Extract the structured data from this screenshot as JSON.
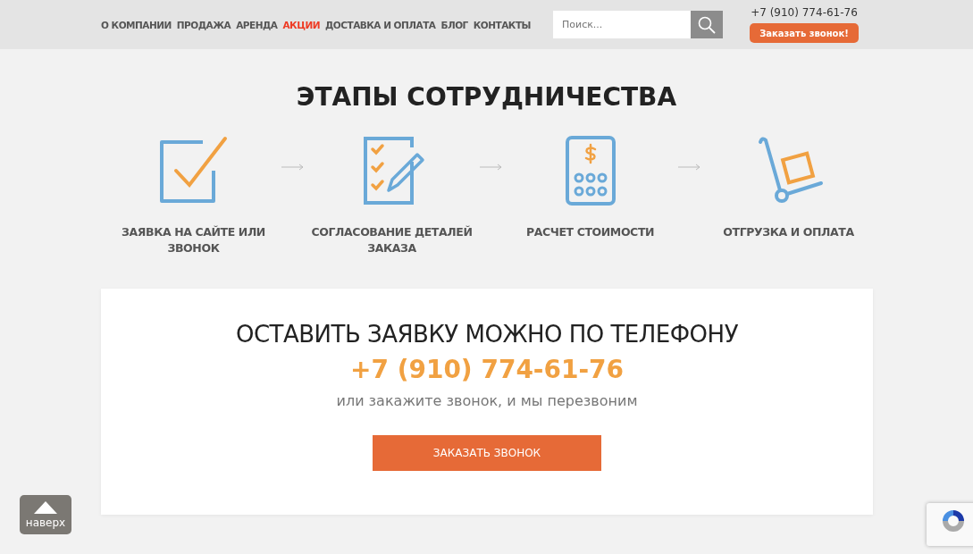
{
  "nav": [
    {
      "label": "О КОМПАНИИ",
      "selected": false
    },
    {
      "label": "ПРОДАЖА",
      "selected": false
    },
    {
      "label": "АРЕНДА",
      "selected": false
    },
    {
      "label": "АКЦИИ",
      "selected": true
    },
    {
      "label": "ДОСТАВКА И ОПЛАТА",
      "selected": false
    },
    {
      "label": "БЛОГ",
      "selected": false
    },
    {
      "label": "КОНТАКТЫ",
      "selected": false
    }
  ],
  "search": {
    "placeholder": "Поиск..."
  },
  "header_phone": "+7 (910) 774-61-76",
  "header_button": "Заказать звонок!",
  "title": "ЭТАПЫ СОТРУДНИЧЕСТВА",
  "steps": [
    {
      "kind": "checkbox",
      "label": "ЗАЯВКА НА САЙТЕ ИЛИ ЗВОНОК"
    },
    {
      "kind": "checklist",
      "label": "СОГЛАСОВАНИЕ ДЕТАЛЕЙ ЗАКАЗА"
    },
    {
      "kind": "calculator",
      "label": "РАСЧЕТ СТОИМОСТИ"
    },
    {
      "kind": "cart",
      "label": "ОТГРУЗКА И ОПЛАТА"
    }
  ],
  "callout": {
    "heading": "ОСТАВИТЬ ЗАЯВКУ МОЖНО ПО ТЕЛЕФОНУ",
    "phone": "+7 (910) 774-61-76",
    "note": "или закажите звонок, и мы перезвоним",
    "button": "ЗАКАЗАТЬ ЗВОНОК"
  },
  "back_to_top": "наверх"
}
